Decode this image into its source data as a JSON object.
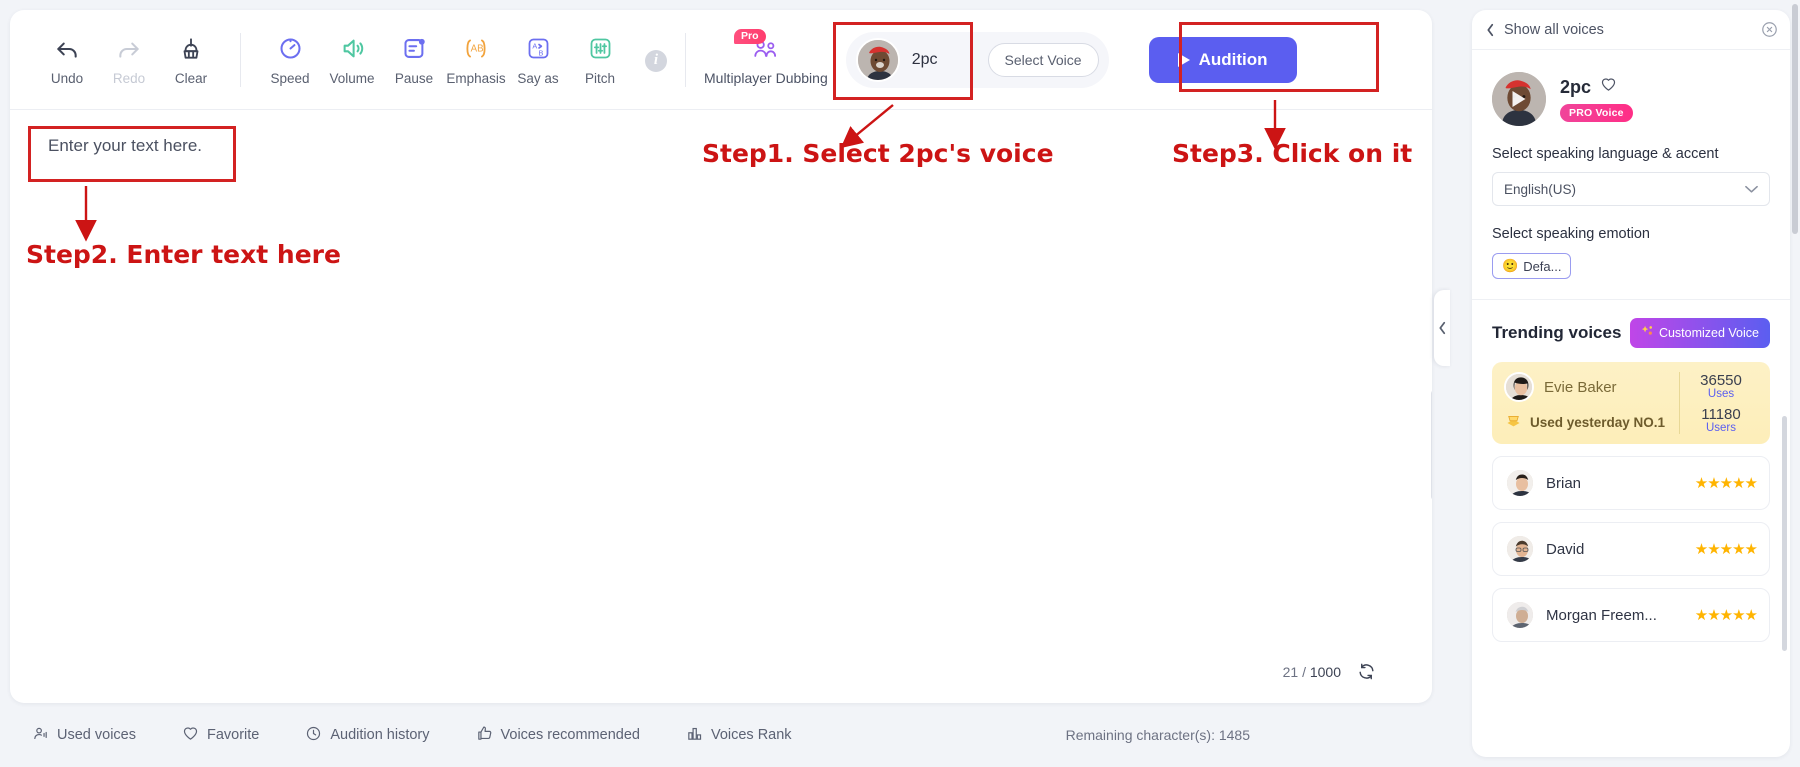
{
  "toolbar": {
    "tools": [
      {
        "name": "undo",
        "label": "Undo",
        "disabled": false
      },
      {
        "name": "redo",
        "label": "Redo",
        "disabled": true
      },
      {
        "name": "clear",
        "label": "Clear",
        "disabled": false
      },
      {
        "name": "speed",
        "label": "Speed",
        "disabled": false
      },
      {
        "name": "volume",
        "label": "Volume",
        "disabled": false
      },
      {
        "name": "pause",
        "label": "Pause",
        "disabled": false
      },
      {
        "name": "emphasis",
        "label": "Emphasis",
        "disabled": false
      },
      {
        "name": "say-as",
        "label": "Say as",
        "disabled": false
      },
      {
        "name": "pitch",
        "label": "Pitch",
        "disabled": false
      }
    ],
    "dubbing": {
      "label": "Multiplayer Dubbing",
      "badge": "Pro"
    },
    "voice": {
      "name": "2pc"
    },
    "select_voice_label": "Select Voice",
    "audition_label": "Audition"
  },
  "editor": {
    "text": "Enter your text here.",
    "char_current": "21",
    "char_separator": "/",
    "char_total": "1000"
  },
  "footer": {
    "items": [
      {
        "name": "used-voices",
        "label": "Used voices",
        "icon": "person-voice-icon"
      },
      {
        "name": "favorite",
        "label": "Favorite",
        "icon": "heart-icon"
      },
      {
        "name": "audition-history",
        "label": "Audition history",
        "icon": "clock-icon"
      },
      {
        "name": "voices-recommended",
        "label": "Voices recommended",
        "icon": "thumbs-up-icon"
      },
      {
        "name": "voices-rank",
        "label": "Voices Rank",
        "icon": "bar-chart-icon"
      }
    ],
    "remaining": "Remaining character(s): 1485"
  },
  "right_panel": {
    "back_label": "Show all voices",
    "voice": {
      "name": "2pc",
      "badge": "PRO Voice"
    },
    "language_section_label": "Select speaking language & accent",
    "language_value": "English(US)",
    "emotion_section_label": "Select speaking emotion",
    "emotion_chip": "Defa...",
    "emotion_emoji": "🙂",
    "trending_title": "Trending voices",
    "customized_voice_label": "Customized Voice",
    "featured": {
      "name": "Evie Baker",
      "subtitle": "Used yesterday NO.1",
      "uses_value": "36550",
      "uses_label": "Uses",
      "users_value": "11180",
      "users_label": "Users"
    },
    "voices": [
      {
        "name": "Brian",
        "stars": "★★★★★"
      },
      {
        "name": "David",
        "stars": "★★★★★"
      },
      {
        "name": "Morgan Freem...",
        "stars": "★★★★★"
      }
    ]
  },
  "annotations": {
    "step1": "Step1. Select 2pc's voice",
    "step2": "Step2. Enter text here",
    "step3": "Step3. Click on it"
  },
  "colors": {
    "accent": "#5b5ef0",
    "annotation": "#cc1414",
    "pro_pink": "#ff3d6e",
    "star": "#ffb400"
  }
}
